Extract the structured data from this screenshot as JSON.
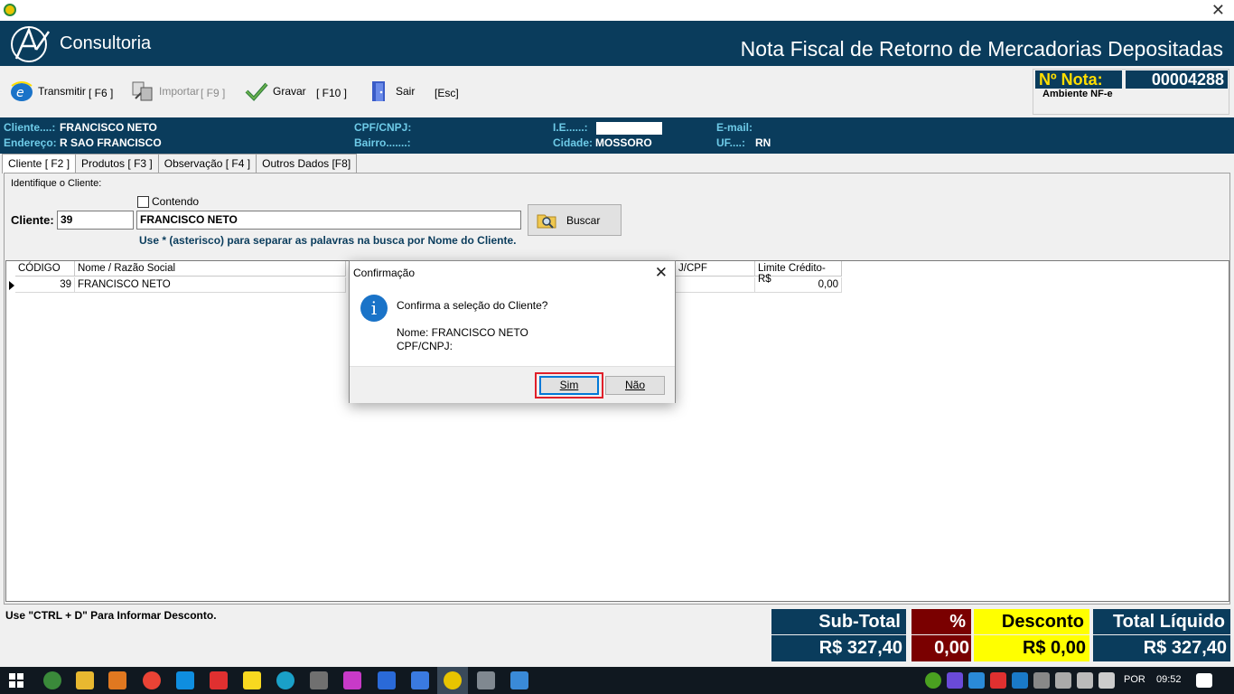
{
  "header": {
    "logo_text": "Consultoria",
    "title": "Nota Fiscal de Retorno de Mercadorias Depositadas"
  },
  "toolbar": {
    "transmitir_label": "Transmitir",
    "transmitir_key": "[ F6 ]",
    "importar_label": "Importar",
    "importar_key": "[ F9 ]",
    "gravar_label": "Gravar",
    "gravar_key": "[ F10 ]",
    "sair_label": "Sair",
    "sair_key": "[Esc]"
  },
  "nota": {
    "label": "Nº Nota:",
    "number": "00004288",
    "ambiente": "Ambiente NF-e"
  },
  "client_info": {
    "cliente_label": "Cliente....:",
    "cliente_value": "FRANCISCO NETO",
    "endereco_label": "Endereço:",
    "endereco_value": "R SAO FRANCISCO",
    "cpf_label": "CPF/CNPJ:",
    "bairro_label": "Bairro.......:",
    "ie_label": "I.E......:",
    "cidade_label": "Cidade:",
    "cidade_value": "MOSSORO",
    "email_label": "E-mail:",
    "uf_label": "UF....:",
    "uf_value": "RN"
  },
  "tabs": [
    "Cliente [ F2 ]",
    "Produtos [ F3 ]",
    "Observação [ F4 ]",
    "Outros Dados [F8]"
  ],
  "search": {
    "group_title": "Identifique o Cliente:",
    "contendo_label": "Contendo",
    "cliente_label": "Cliente:",
    "code_value": "39",
    "name_value": "FRANCISCO NETO",
    "hint": "Use * (asterisco) para separar as palavras na busca por Nome do Cliente.",
    "buscar_label": "Buscar"
  },
  "grid": {
    "columns": [
      "CÓDIGO",
      "Nome / Razão Social",
      "J/CPF",
      "Limite Crédito-R$"
    ],
    "rows": [
      {
        "codigo": "39",
        "nome": "FRANCISCO NETO",
        "cpf": "",
        "limite": "0,00"
      }
    ]
  },
  "footer": {
    "hint": "Use \"CTRL + D\" Para Informar Desconto.",
    "subtotal_label": "Sub-Total",
    "subtotal_value": "R$ 327,40",
    "pct_label": "%",
    "pct_value": "0,00",
    "desconto_label": "Desconto",
    "desconto_value": "R$ 0,00",
    "total_label": "Total Líquido",
    "total_value": "R$ 327,40"
  },
  "dialog": {
    "title": "Confirmação",
    "message": "Confirma a seleção do Cliente?",
    "nome_line": "Nome: FRANCISCO NETO",
    "cpf_line": "CPF/CNPJ:",
    "sim_label": "Sim",
    "nao_label": "Não"
  },
  "taskbar": {
    "language": "POR",
    "time": "09:52"
  },
  "colors": {
    "navy": "#0a3c5c",
    "maroon": "#7a0000",
    "yellow": "#ffff00",
    "highlight_red": "#e0202a"
  }
}
